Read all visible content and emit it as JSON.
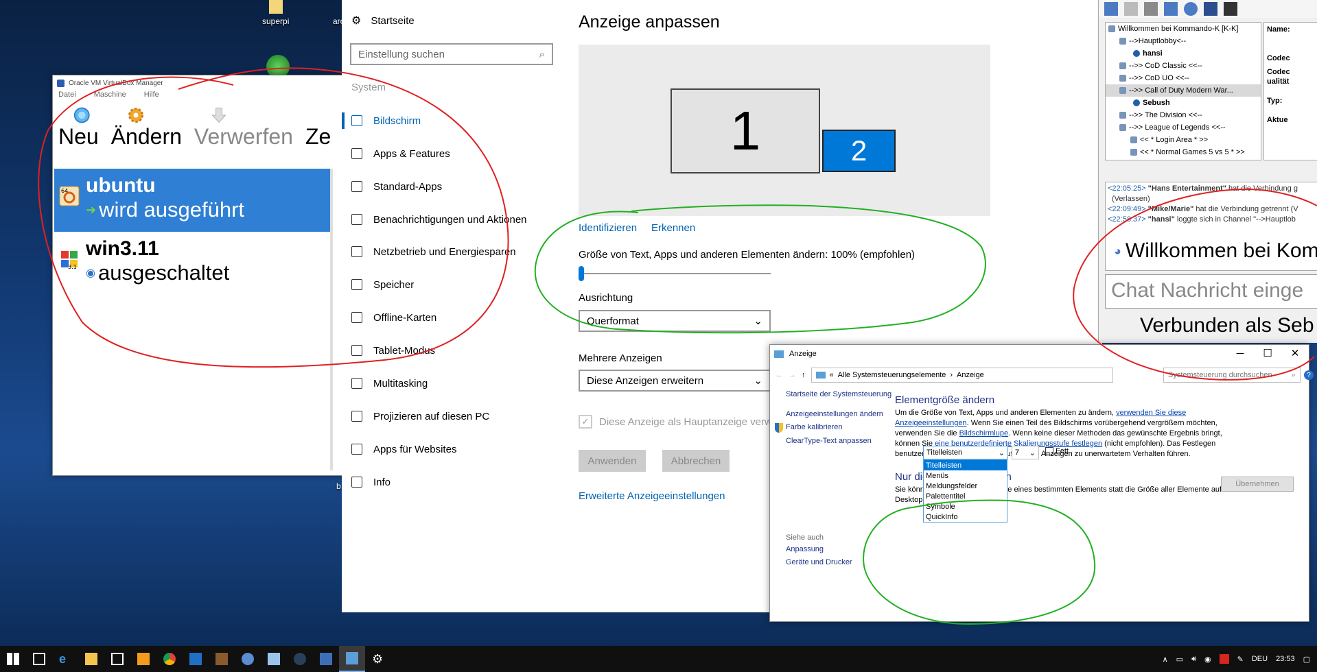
{
  "desktop": {
    "icons": [
      {
        "label": "superpi"
      },
      {
        "label": "arc"
      },
      {
        "label": "b"
      }
    ]
  },
  "vbox": {
    "window_title": "Oracle VM VirtualBox Manager",
    "menu": [
      "Datei",
      "Maschine",
      "Hilfe"
    ],
    "toolbar": [
      {
        "label": "Neu",
        "icon": "new-icon"
      },
      {
        "label": "Ändern",
        "icon": "settings-gear-icon"
      },
      {
        "label": "Verwerfen",
        "icon": "discard-arrow-icon"
      },
      {
        "label": "Ze",
        "icon": "show-icon"
      }
    ],
    "vms": [
      {
        "name": "ubuntu",
        "state": "wird ausgeführt",
        "badge": "64"
      },
      {
        "name": "win3.11",
        "state": "ausgeschaltet",
        "badge": "3.1"
      }
    ]
  },
  "settings": {
    "home": "Startseite",
    "search_placeholder": "Einstellung suchen",
    "section": "System",
    "nav": [
      {
        "label": "Bildschirm",
        "icon": "display-icon"
      },
      {
        "label": "Apps & Features",
        "icon": "apps-list-icon"
      },
      {
        "label": "Standard-Apps",
        "icon": "default-apps-icon"
      },
      {
        "label": "Benachrichtigungen und Aktionen",
        "icon": "notification-icon"
      },
      {
        "label": "Netzbetrieb und Energiesparen",
        "icon": "power-icon"
      },
      {
        "label": "Speicher",
        "icon": "storage-icon"
      },
      {
        "label": "Offline-Karten",
        "icon": "map-icon"
      },
      {
        "label": "Tablet-Modus",
        "icon": "tablet-icon"
      },
      {
        "label": "Multitasking",
        "icon": "multitasking-icon"
      },
      {
        "label": "Projizieren auf diesen PC",
        "icon": "project-icon"
      },
      {
        "label": "Apps für Websites",
        "icon": "web-apps-icon"
      },
      {
        "label": "Info",
        "icon": "info-icon"
      }
    ],
    "content": {
      "title": "Anzeige anpassen",
      "monitor1": "1",
      "monitor2": "2",
      "identify": "Identifizieren",
      "detect": "Erkennen",
      "scale_label": "Größe von Text, Apps und anderen Elementen ändern: 100% (empfohlen)",
      "scale_value": 0,
      "orientation_label": "Ausrichtung",
      "orientation_value": "Querformat",
      "multi_label": "Mehrere Anzeigen",
      "multi_value": "Diese Anzeigen erweitern",
      "main_display": "Diese Anzeige als Hauptanzeige verwe",
      "apply": "Anwenden",
      "cancel": "Abbrechen",
      "advanced": "Erweiterte Anzeigeeinstellungen"
    }
  },
  "teamspeak": {
    "tree": [
      {
        "text": "Willkommen bei Kommando-K  [K-K]",
        "type": "server"
      },
      {
        "text": "-->Hauptlobby<--",
        "type": "channel"
      },
      {
        "text": "hansi",
        "type": "user"
      },
      {
        "text": "-->> CoD Classic <<--",
        "type": "channel"
      },
      {
        "text": "-->> CoD UO <<--",
        "type": "channel"
      },
      {
        "text": "-->> Call of Duty  Modern War...",
        "type": "channel"
      },
      {
        "text": "Sebush",
        "type": "user"
      },
      {
        "text": "-->> The Division <<--",
        "type": "channel"
      },
      {
        "text": "-->> League of Legends <<--",
        "type": "channel"
      },
      {
        "text": "<< * Login Area * >>",
        "type": "subchannel"
      },
      {
        "text": "<< * Normal Games 5 vs 5 * >>",
        "type": "subchannel"
      }
    ],
    "info": [
      "Name:",
      "Codec",
      "Codec",
      "ualität",
      "Typ:",
      "Aktue"
    ],
    "log": [
      {
        "time": "<22:05:25>",
        "who": "\"Hans Entertainment\"",
        "text": "hat die Verbindung g"
      },
      {
        "time": "",
        "who": "",
        "text": "(Verlassen)"
      },
      {
        "time": "<22:09:49>",
        "who": "\"Mike/Marie\"",
        "text": "hat die Verbindung getrennt (V"
      },
      {
        "time": "<22:58:37>",
        "who": "\"hansi\"",
        "text": "loggte sich in Channel \"-->Hauptlob"
      }
    ],
    "welcome": "Willkommen bei Kom",
    "chat_placeholder": "Chat Nachricht einge",
    "status": "Verbunden als Seb"
  },
  "control_panel": {
    "title": "Anzeige",
    "path_root": "Alle Systemsteuerungselemente",
    "path_leaf": "Anzeige",
    "search_placeholder": "Systemsteuerung durchsuchen",
    "sidebar": [
      "Startseite der Systemsteuerung",
      "Anzeigeeinstellungen ändern",
      "Farbe kalibrieren",
      "ClearType-Text anpassen"
    ],
    "see_also": "Siehe auch",
    "see_also_links": [
      "Anpassung",
      "Geräte und Drucker"
    ],
    "heading1": "Elementgröße ändern",
    "p1_a": "Um die Größe von Text, Apps und anderen Elementen zu ändern,",
    "p1_link1": "verwenden Sie diese",
    "p1_link1b": "Anzeigeeinstellungen",
    "p1_b": ". Wenn Sie einen Teil des Bildschirms vorübergehend vergrößern möchten,",
    "p1_c": "verwenden Sie die",
    "p1_link2": "Bildschirmlupe",
    "p1_d": ". Wenn keine dieser Methoden das gewünschte Ergebnis bringt,",
    "p1_e": "können Sie",
    "p1_link3": "eine benutzerdefinierte Skalierungsstufe festlegen",
    "p1_f": "(nicht empfohlen). Das Festlegen",
    "p1_g": "benutzerdefinierter Stufen kann auf einigen Anzeigen zu unerwartetem Verhalten führen.",
    "heading2": "Nur die Textgröße ändern",
    "p2_a": "Sie können auch nur die Textgröße eines bestimmten Elements statt die Größe aller Elemente auf dem",
    "p2_b": "Desktop ändern.",
    "element_selected": "Titelleisten",
    "element_options": [
      "Titelleisten",
      "Menüs",
      "Meldungsfelder",
      "Palettentitel",
      "Symbole",
      "QuickInfo"
    ],
    "size_value": "7",
    "bold_label": "Fett",
    "apply": "Übernehmen"
  },
  "taskbar": {
    "tray": {
      "lang": "DEU",
      "time": "23:53"
    }
  },
  "colors": {
    "accent": "#0078d7",
    "link": "#0063b1",
    "annotation_red": "#e02020",
    "annotation_green": "#22b022"
  }
}
